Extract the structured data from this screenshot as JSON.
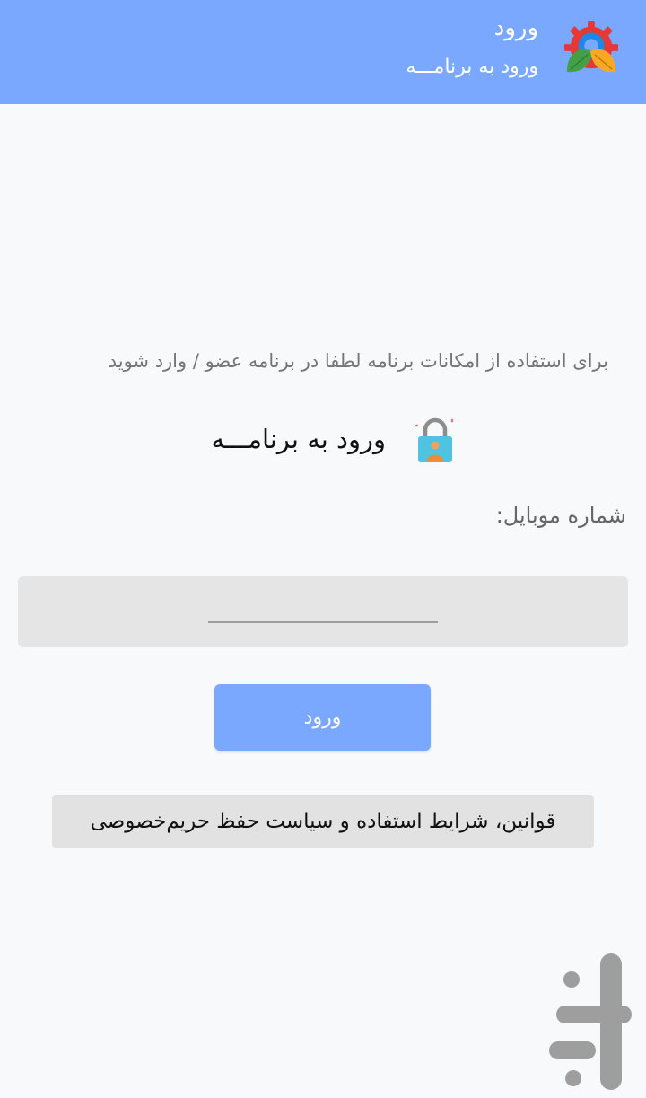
{
  "header": {
    "title": "ورود",
    "subtitle": "ورود به برنامـــه",
    "logo_icon": "gear-leaf-logo-icon",
    "background_color": "#7aa8ff"
  },
  "main": {
    "intro_text": "برای استفاده از امکانات برنامه لطفا در برنامه عضو / وارد شوید",
    "section_title": "ورود به برنامـــه",
    "section_icon": "lock-user-icon",
    "mobile_label": "شماره موبایل:",
    "mobile_value": "",
    "login_label": "ورود",
    "terms_label": "قوانین، شرایط استفاده و سیاست حفظ حریم‌خصوصی"
  },
  "watermark": {
    "icon": "app-store-watermark-icon"
  },
  "colors": {
    "accent": "#7aa8ff",
    "page_background": "#f8f9fb",
    "input_background": "#e5e5e5",
    "terms_background": "#e2e2e2"
  }
}
